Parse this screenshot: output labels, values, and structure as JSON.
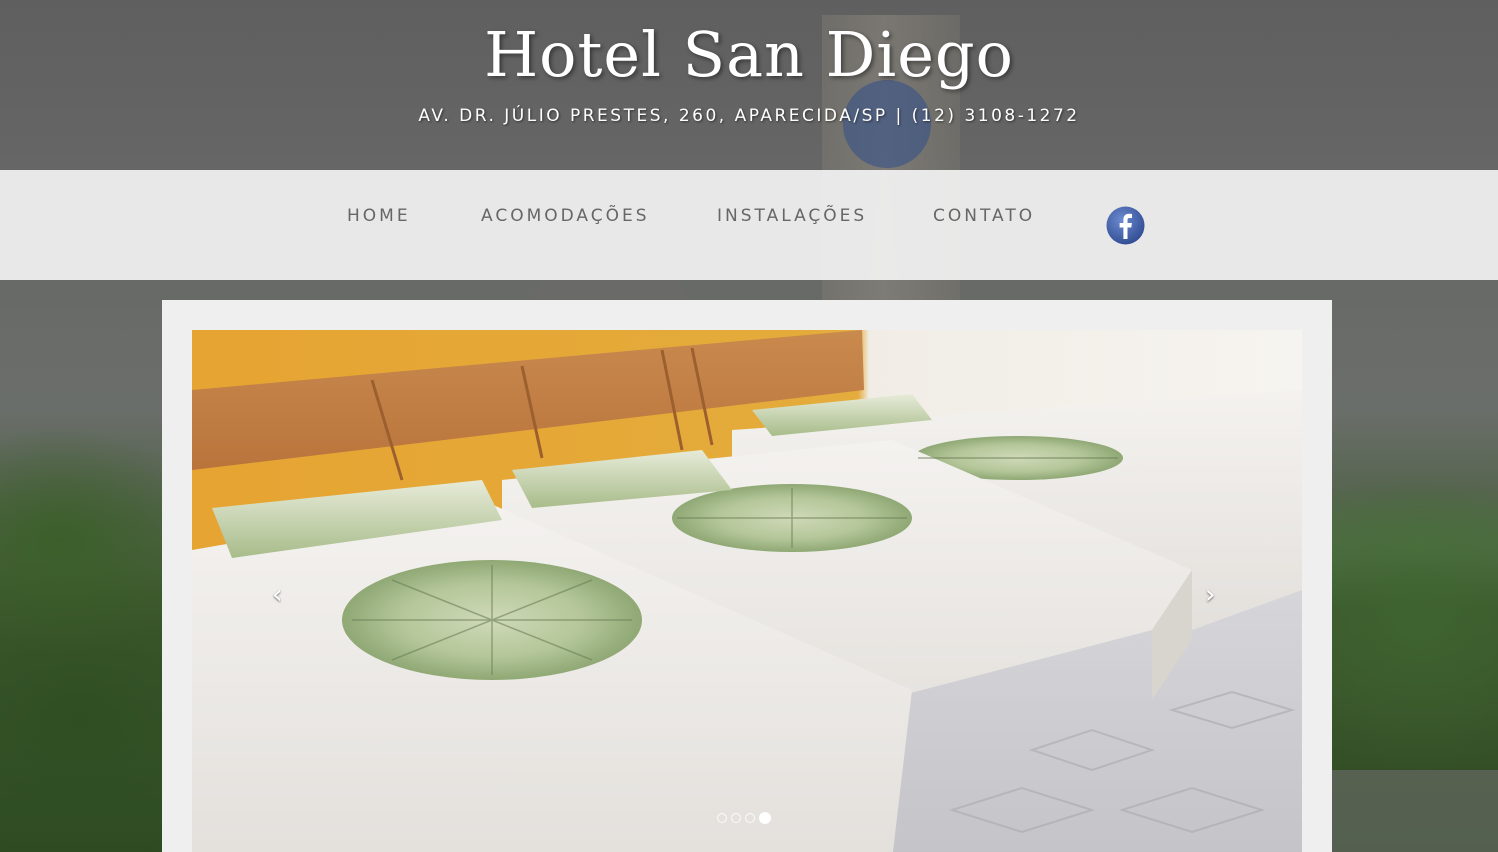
{
  "header": {
    "title": "Hotel San Diego",
    "subtitle": "AV. DR. JÚLIO PRESTES, 260, APARECIDA/SP | (12) 3108-1272"
  },
  "nav": {
    "items": [
      {
        "label": "HOME"
      },
      {
        "label": "ACOMODAÇÕES"
      },
      {
        "label": "INSTALAÇÕES"
      },
      {
        "label": "CONTATO"
      }
    ],
    "social": {
      "icon": "facebook-icon",
      "color": "#3b5998"
    }
  },
  "slider": {
    "prev_label": "‹",
    "next_label": "›",
    "slide_count": 4,
    "active_slide": 4,
    "image_description_icon": "room-photo"
  },
  "colors": {
    "nav_text": "#666666",
    "nav_background": "#f2f2f2",
    "title": "#ffffff"
  }
}
